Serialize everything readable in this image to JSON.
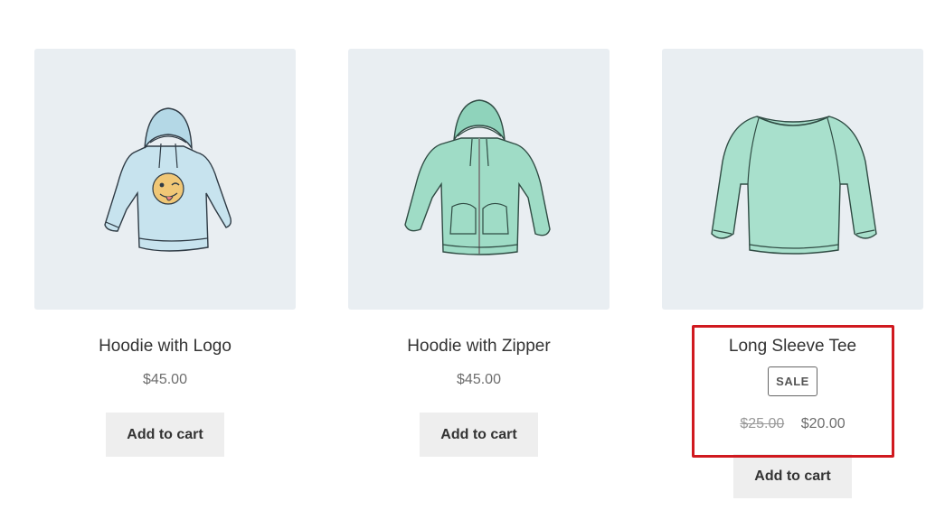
{
  "products": [
    {
      "name": "Hoodie with Logo",
      "price": "$45.00",
      "button": "Add to cart",
      "image_icon": "hoodie-with-logo-icon"
    },
    {
      "name": "Hoodie with Zipper",
      "price": "$45.00",
      "button": "Add to cart",
      "image_icon": "hoodie-with-zipper-icon"
    },
    {
      "name": "Long Sleeve Tee",
      "badge": "SALE",
      "regular_price": "$25.00",
      "sale_price": "$20.00",
      "button": "Add to cart",
      "image_icon": "long-sleeve-tee-icon"
    }
  ],
  "colors": {
    "thumb_bg": "#e9eef2",
    "hoodie_light_blue": "#c7e3ee",
    "garment_mint": "#9fdcc6",
    "highlight_red": "#d0191f",
    "button_bg": "#eeeeee"
  }
}
